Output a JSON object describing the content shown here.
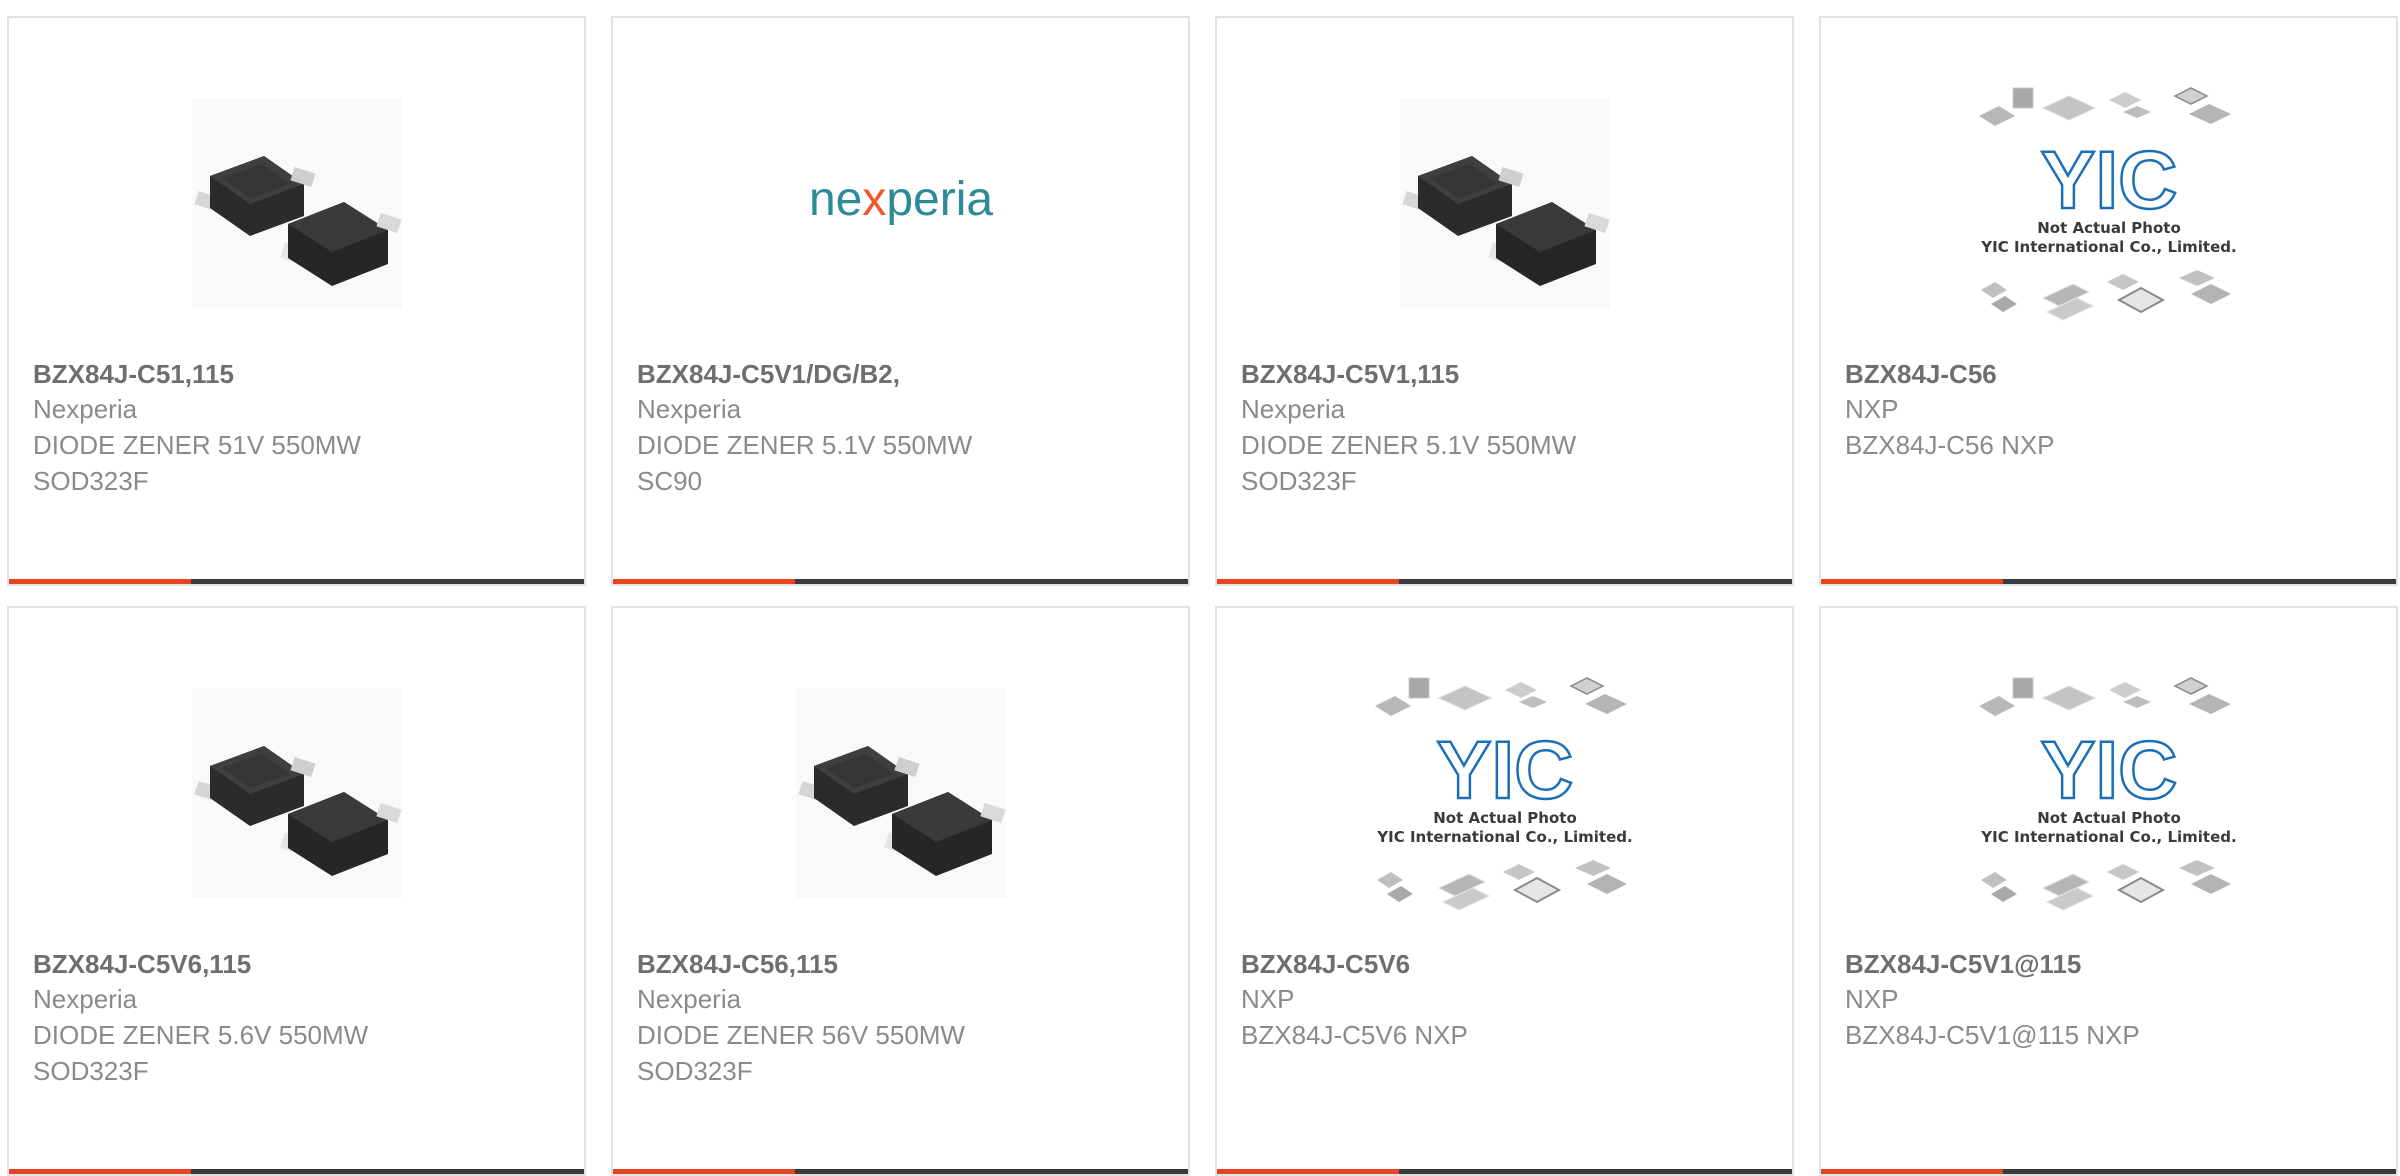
{
  "products": [
    {
      "part_number": "BZX84J-C51,115",
      "manufacturer": "Nexperia",
      "description": "DIODE ZENER 51V 550MW",
      "package": "SOD323F",
      "image": "diode-package-icon"
    },
    {
      "part_number": "BZX84J-C5V1/DG/B2,",
      "manufacturer": "Nexperia",
      "description": "DIODE ZENER 5.1V 550MW",
      "package": "SC90",
      "image": "nexperia-logo",
      "logo_text": {
        "pre": "ne",
        "x": "x",
        "post": "peria"
      }
    },
    {
      "part_number": "BZX84J-C5V1,115",
      "manufacturer": "Nexperia",
      "description": "DIODE ZENER 5.1V 550MW",
      "package": "SOD323F",
      "image": "diode-package-icon"
    },
    {
      "part_number": "BZX84J-C56",
      "manufacturer": "NXP",
      "description": "BZX84J-C56 NXP",
      "package": "",
      "image": "yic-placeholder"
    },
    {
      "part_number": "BZX84J-C5V6,115",
      "manufacturer": "Nexperia",
      "description": "DIODE ZENER 5.6V 550MW",
      "package": "SOD323F",
      "image": "diode-package-icon"
    },
    {
      "part_number": "BZX84J-C56,115",
      "manufacturer": "Nexperia",
      "description": "DIODE ZENER 56V 550MW",
      "package": "SOD323F",
      "image": "diode-package-icon"
    },
    {
      "part_number": "BZX84J-C5V6",
      "manufacturer": "NXP",
      "description": "BZX84J-C5V6 NXP",
      "package": "",
      "image": "yic-placeholder"
    },
    {
      "part_number": "BZX84J-C5V1@115",
      "manufacturer": "NXP",
      "description": "BZX84J-C5V1@115 NXP",
      "package": "",
      "image": "yic-placeholder"
    }
  ],
  "placeholder": {
    "brand": "YIC",
    "line1": "Not Actual Photo",
    "line2": "YIC International Co., Limited."
  },
  "colors": {
    "accent": "#e8431f",
    "bar": "#3a3a3a",
    "nexperia_teal": "#2d8a99",
    "nexperia_orange": "#f0572a",
    "yic_blue": "#1a6fb8"
  }
}
